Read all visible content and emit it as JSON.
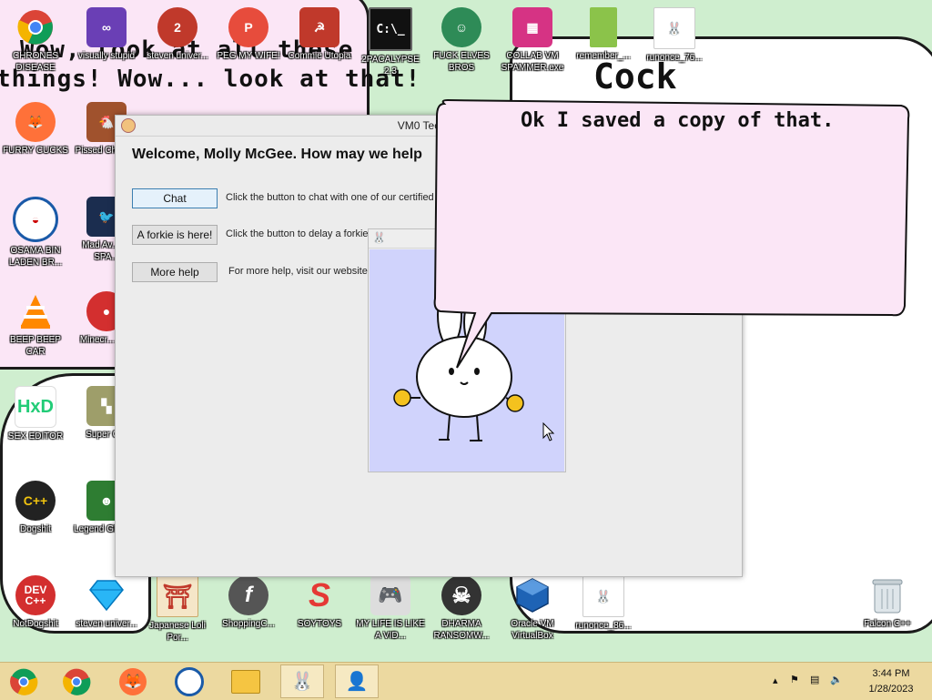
{
  "wallpaper": {
    "text_line1": "Wow, look at all these",
    "text_line2": "things! Wow... look at that!",
    "big_text": "Cock"
  },
  "desktop_icons": [
    {
      "label": "CHRONES DISEASE",
      "icon": "chrome-icon"
    },
    {
      "label": "visually stupid",
      "icon": "visual-studio-icon"
    },
    {
      "label": "steven univer...",
      "icon": "steven-icon"
    },
    {
      "label": "PEG MY WIFE!",
      "icon": "peg-icon"
    },
    {
      "label": "Commie Utopia",
      "icon": "commie-icon"
    },
    {
      "label": "2PACALYPSE 2.3",
      "icon": "cmd-icon"
    },
    {
      "label": "FUCK ELVES BROS",
      "icon": "elf-icon"
    },
    {
      "label": "COLLAB VM SPAMMER.exe",
      "icon": "collab-icon"
    },
    {
      "label": "remember_...",
      "icon": "file-icon"
    },
    {
      "label": "runonce_76...",
      "icon": "bunny-file-icon"
    },
    {
      "label": "FURRY CUCKS",
      "icon": "firefox-icon"
    },
    {
      "label": "Pissed Chicken",
      "icon": "chicken-icon"
    },
    {
      "label": "OSAMA BIN LADEN BR...",
      "icon": "obama-icon"
    },
    {
      "label": "Mad Av... IN SPA...",
      "icon": "angry-birds-space-icon"
    },
    {
      "label": "BEEP BEEP CAR",
      "icon": "vlc-icon"
    },
    {
      "label": "Minecr... Bird",
      "icon": "angry-bird-icon"
    },
    {
      "label": "SEX EDITOR",
      "icon": "hxd-icon"
    },
    {
      "label": "Super G...",
      "icon": "super-icon"
    },
    {
      "label": "Dogshit",
      "icon": "cpp-icon"
    },
    {
      "label": "Legend GRYA...",
      "icon": "legend-icon"
    },
    {
      "label": "NotDogshit",
      "icon": "dev-cpp-icon"
    },
    {
      "label": "steven univer...",
      "icon": "gem-icon"
    },
    {
      "label": "Japanese Loli Por...",
      "icon": "torii-icon"
    },
    {
      "label": "ShoppingC...",
      "icon": "flash-icon"
    },
    {
      "label": "SOYTOYS",
      "icon": "s-icon"
    },
    {
      "label": "MY LIFE IS LIKE A VID...",
      "icon": "gamepad-icon"
    },
    {
      "label": "DHARMA RANSOMW...",
      "icon": "skull-icon"
    },
    {
      "label": "Oracle VM VirtualBox",
      "icon": "virtualbox-icon"
    },
    {
      "label": "runonce_86...",
      "icon": "bunny-file-icon"
    },
    {
      "label": "Falcon C++",
      "icon": "recycle-bin-icon"
    }
  ],
  "app_window": {
    "title": "VM0 Technic",
    "welcome": "Welcome, Molly McGee. How may we help",
    "buttons": [
      {
        "label": "Chat",
        "desc": "Click the button to chat with one of our certified t"
      },
      {
        "label": "A forkie is here!",
        "desc": "Click the button to delay a forkie!"
      },
      {
        "label": "More help",
        "desc": "For more help, visit our website."
      }
    ]
  },
  "speech_bubble": {
    "text": "Ok I saved a copy of that."
  },
  "taskbar": {
    "items": [
      "chrome-alt-icon",
      "chrome-icon",
      "firefox-icon",
      "obama-icon",
      "file-explorer-icon",
      "bunny-icon",
      "support-person-icon"
    ],
    "clock_time": "3:44 PM",
    "clock_date": "1/28/2023"
  },
  "colors": {
    "wallpaper_bg": "#cfeecf",
    "bubble_bg": "#fbe6f6",
    "taskbar_bg": "#ecd9a0",
    "bunny_canvas_bg": "#d0d3fc"
  }
}
